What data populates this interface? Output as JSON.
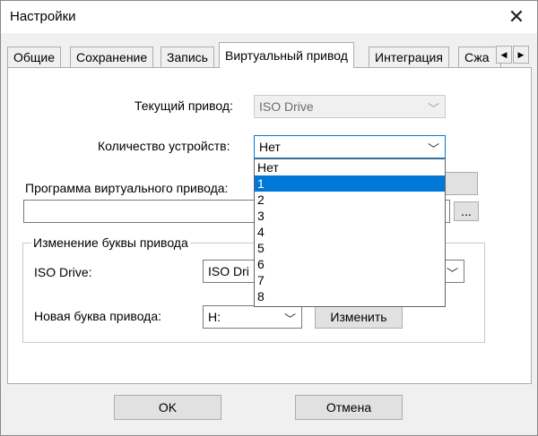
{
  "window": {
    "title": "Настройки",
    "close_label": "✕"
  },
  "tabs": [
    {
      "label": "Общие",
      "active": false
    },
    {
      "label": "Сохранение",
      "active": false
    },
    {
      "label": "Запись",
      "active": false
    },
    {
      "label": "Виртуальный привод",
      "active": true
    },
    {
      "label": "Интеграция",
      "active": false
    },
    {
      "label": "Сжа",
      "active": false
    }
  ],
  "tab_scroll": {
    "left": "◀",
    "right": "▶"
  },
  "form": {
    "current_drive_label": "Текущий привод:",
    "current_drive_value": "ISO Drive",
    "device_count_label": "Количество устройств:",
    "device_count_value": "Нет",
    "program_label": "Программа виртуального привода:",
    "program_path": "",
    "browse_label": "..."
  },
  "dropdown": {
    "options": [
      "Нет",
      "1",
      "2",
      "3",
      "4",
      "5",
      "6",
      "7",
      "8"
    ],
    "highlighted": "1"
  },
  "group": {
    "title": "Изменение буквы привода",
    "drive_label": "ISO Drive:",
    "drive_value": "ISO Dri",
    "new_letter_label": "Новая буква привода:",
    "new_letter_value": "H:",
    "change_button": "Изменить"
  },
  "footer": {
    "ok": "OK",
    "cancel": "Отмена"
  },
  "icons": {
    "chevron": "chevron-down-icon"
  }
}
